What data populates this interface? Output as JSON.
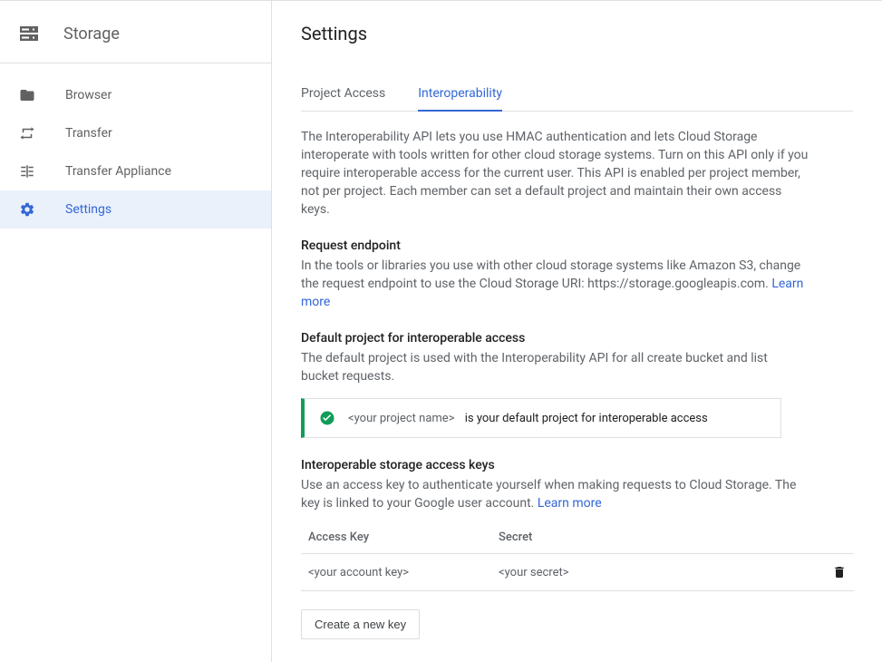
{
  "sidebar": {
    "title": "Storage",
    "items": [
      {
        "label": "Browser"
      },
      {
        "label": "Transfer"
      },
      {
        "label": "Transfer Appliance"
      },
      {
        "label": "Settings"
      }
    ]
  },
  "page": {
    "title": "Settings"
  },
  "tabs": [
    {
      "label": "Project Access"
    },
    {
      "label": "Interoperability"
    }
  ],
  "intro": "The Interoperability API lets you use HMAC authentication and lets Cloud Storage interoperate with tools written for other cloud storage systems. Turn on this API only if you require interoperable access for the current user. This API is enabled per project member, not per project. Each member can set a default project and maintain their own access keys.",
  "request": {
    "heading": "Request endpoint",
    "body_prefix": "In the tools or libraries you use with other cloud storage systems like Amazon S3, change the request endpoint to use the Cloud Storage URI: https://storage.googleapis.com. ",
    "learn_more": "Learn more"
  },
  "default_project": {
    "heading": "Default project for interoperable access",
    "body": "The default project is used with the Interoperability API for all create bucket and list bucket requests.",
    "callout_project": "<your project name>",
    "callout_suffix": "is your default project for interoperable access"
  },
  "keys": {
    "heading": "Interoperable storage access keys",
    "body_prefix": "Use an access key to authenticate yourself when making requests to Cloud Storage. The key is linked to your Google user account. ",
    "learn_more": "Learn more",
    "col_key": "Access Key",
    "col_secret": "Secret",
    "row_key": "<your account key>",
    "row_secret": "<your secret>",
    "create_button": "Create a new key"
  }
}
